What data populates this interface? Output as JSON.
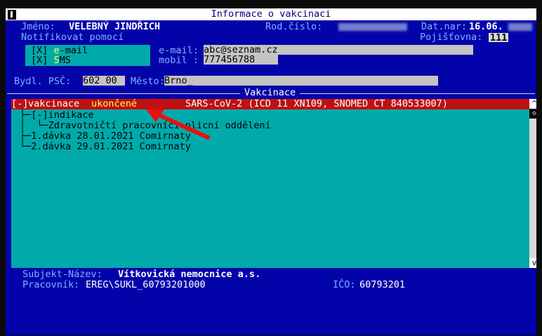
{
  "window": {
    "title": "Informace o vakcinaci"
  },
  "patient": {
    "name_label": "Jméno:",
    "name": "VELEBNÝ JINDŘICH",
    "rc_label": "Rod.číslo:",
    "dob_label": "Dat.nar:",
    "dob": "16.06.",
    "insurer_label": "Pojišťovna:",
    "insurer": "111"
  },
  "notify": {
    "label": "Notifikovat pomocí",
    "email_check": {
      "mark": "[X]",
      "first": "e",
      "rest": "-mail"
    },
    "sms_check": {
      "mark": "[X]",
      "first": "S",
      "rest": "MS"
    },
    "email_label": "e-mail:",
    "email_value": "abc@seznam.cz",
    "mobile_label": "mobil :",
    "mobile_value": "777456788"
  },
  "address": {
    "label": "Bydl. PSČ:",
    "psc": "602 00",
    "city_label": "Město:",
    "city": "Brno_"
  },
  "section": {
    "title": "Vakcinace"
  },
  "tree": {
    "root": {
      "prefix": "[-]",
      "label_a": "vakcinace ",
      "label_b": "ukončené",
      "detail": "SARS-CoV-2 (ICD 11 XN109, SNOMED CT 840533007)"
    },
    "rows": [
      "├─[-]indikace",
      "│  └─Zdravotničtí pracovníci plicní oddělení",
      "├─1.dávka 28.01.2021 Comirnaty",
      "└─2.dávka 29.01.2021 Comirnaty"
    ]
  },
  "scrollbar": {
    "up": "^",
    "thumb": "◇",
    "down": "v"
  },
  "footer": {
    "subject_label": "Subjekt-Název:",
    "subject": "Vítkovická nemocnice a.s.",
    "worker_label": "Pracovník:",
    "worker": "EREG\\SUKL_60793201000",
    "ico_label": "IČO:",
    "ico": "60793201"
  },
  "colors": {
    "background": "#0303aa",
    "panel": "#00aaaa",
    "selected_row": "#c01010",
    "annotation_arrow": "#e81010"
  },
  "icons": {
    "close": "window-close-icon",
    "annotation": "red-arrow-annotation-icon"
  }
}
